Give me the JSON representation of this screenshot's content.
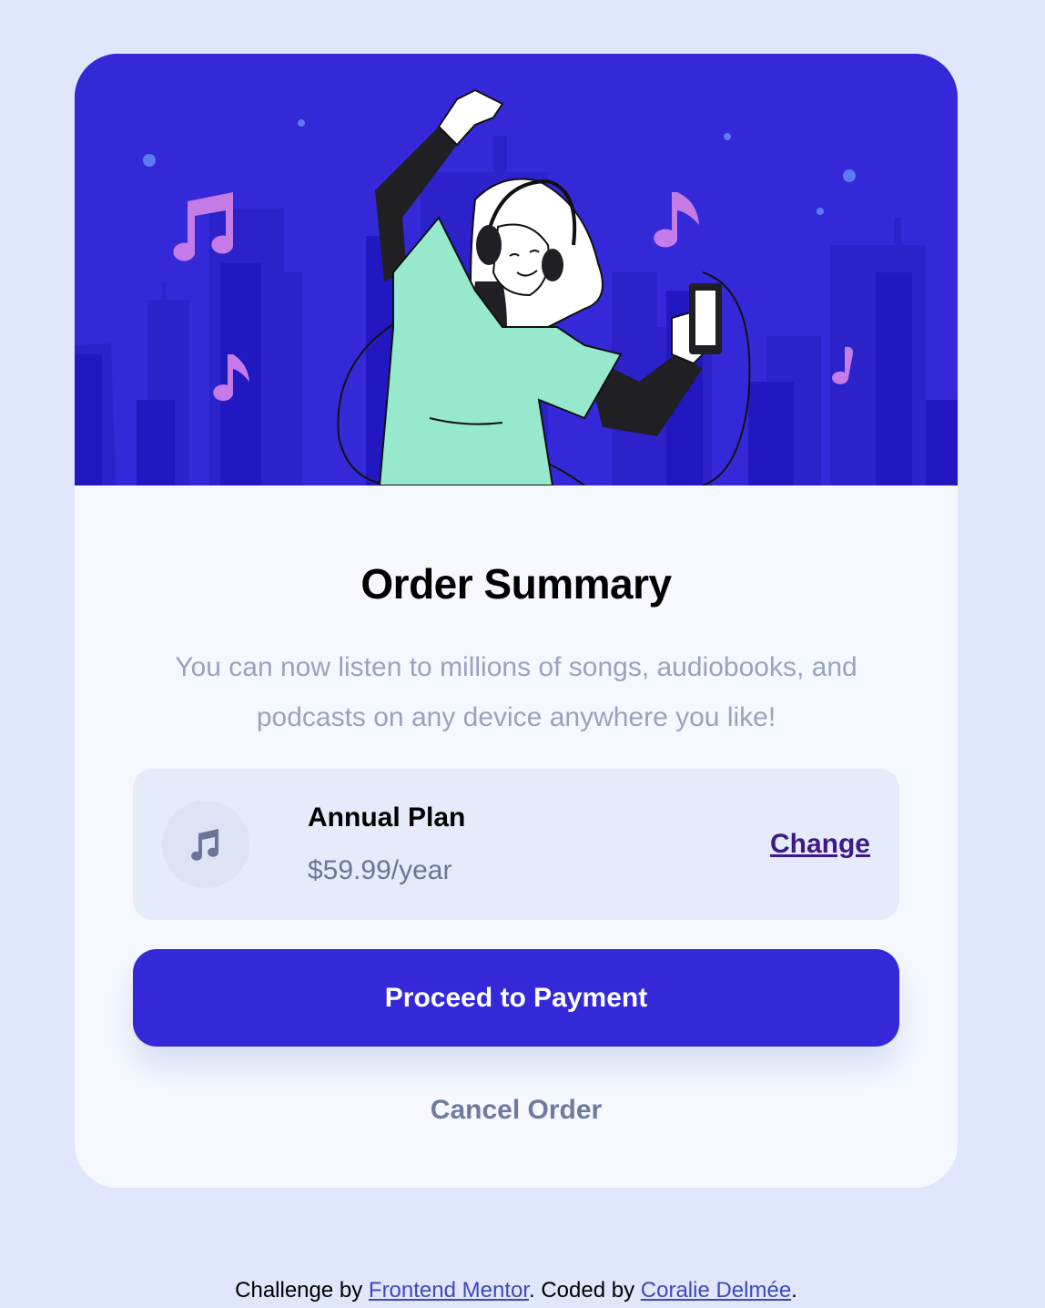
{
  "colors": {
    "page_background": "#e0e6fb",
    "card_background": "#f5f8ff",
    "hero_background": "#3429d8",
    "primary_button": "#3429d8",
    "change_link": "#3e1a88",
    "muted_text": "#9aa3be",
    "price_text": "#6b7598",
    "cancel_text": "#6f7a9e",
    "music_notes": "#c57ce8",
    "shirt": "#96e9cd"
  },
  "hero": {
    "illustration": "person-dancing-with-headphones-illustration"
  },
  "summary": {
    "title": "Order Summary",
    "description": "You can now listen to millions of songs, audiobooks, and podcasts on any device anywhere you like!"
  },
  "plan": {
    "icon": "music-note-icon",
    "name": "Annual Plan",
    "price": "$59.99/year",
    "change_label": "Change"
  },
  "actions": {
    "proceed_label": "Proceed to Payment",
    "cancel_label": "Cancel Order"
  },
  "footer": {
    "challenge_prefix": "Challenge by ",
    "challenge_link": "Frontend Mentor",
    "coded_prefix": ". Coded by ",
    "coded_link": "Coralie Delmée",
    "suffix": "."
  }
}
